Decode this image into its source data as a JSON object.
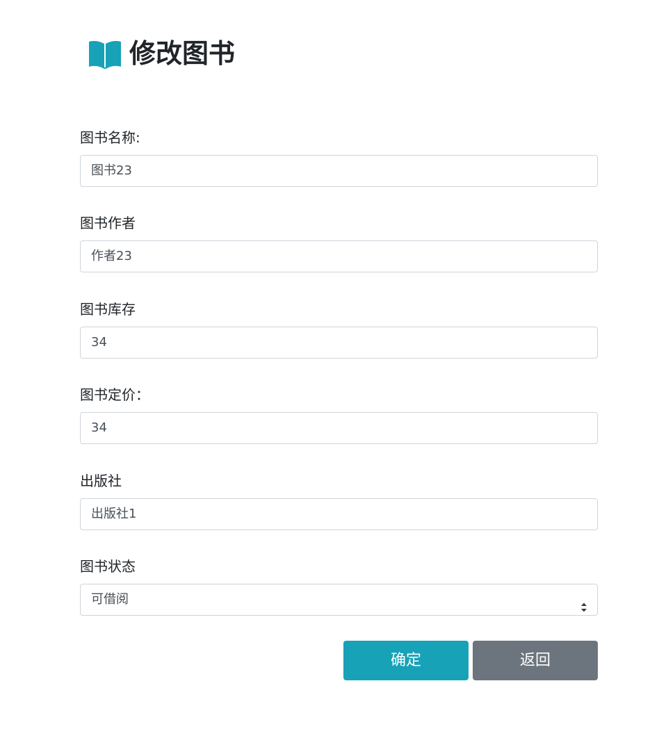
{
  "header": {
    "title": "修改图书",
    "icon": "book-open-icon",
    "icon_color": "#17a2b8"
  },
  "form": {
    "name": {
      "label": "图书名称:",
      "value": "图书23"
    },
    "author": {
      "label": "图书作者",
      "value": "作者23"
    },
    "stock": {
      "label": "图书库存",
      "value": "34"
    },
    "price": {
      "label": "图书定价：",
      "value": "34"
    },
    "publisher": {
      "label": "出版社",
      "value": "出版社1"
    },
    "status": {
      "label": "图书状态",
      "selected": "可借阅"
    }
  },
  "buttons": {
    "confirm": {
      "label": "确定",
      "color": "#17a2b8"
    },
    "back": {
      "label": "返回",
      "color": "#6c757d"
    }
  }
}
